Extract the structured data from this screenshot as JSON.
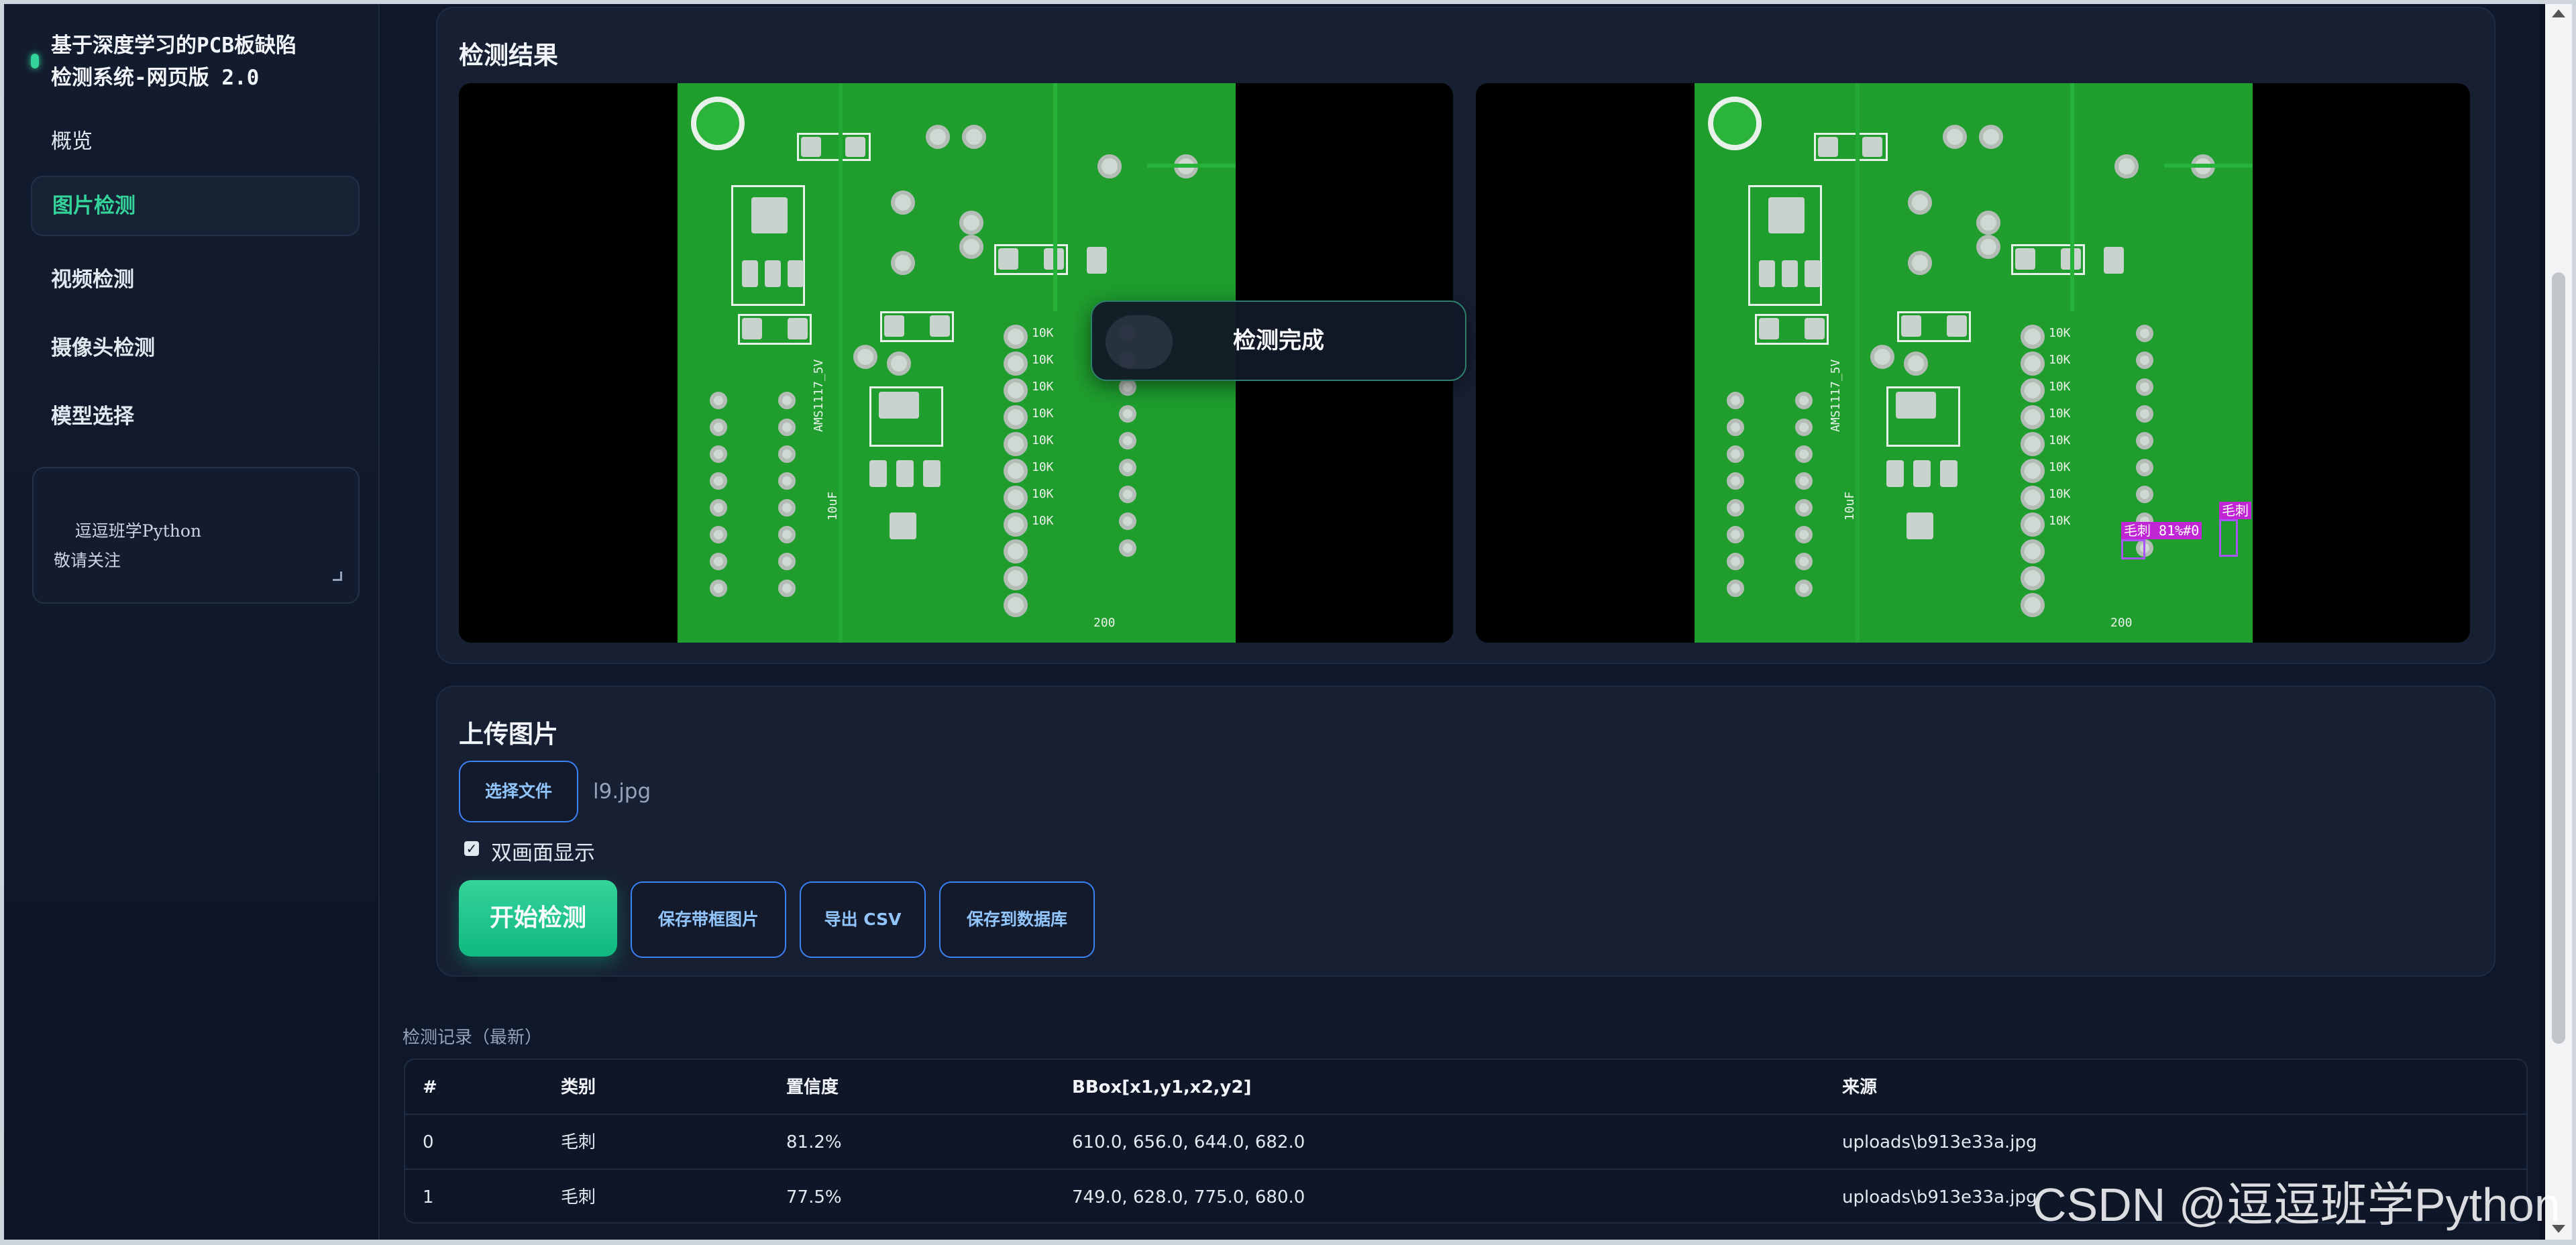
{
  "sidebar": {
    "title": "基于深度学习的PCB板缺陷\n检测系统-网页版 2.0",
    "items": [
      {
        "label": "概览"
      },
      {
        "label": "图片检测"
      },
      {
        "label": "视频检测"
      },
      {
        "label": "摄像头检测"
      },
      {
        "label": "模型选择"
      }
    ],
    "note": "逗逗班学Python\n敬请关注"
  },
  "results": {
    "title": "检测结果",
    "toast": "检测完成",
    "detections": [
      {
        "label": "毛刺 81%#0"
      },
      {
        "label": "毛刺"
      }
    ],
    "pcb_labels": [
      "10K",
      "10uF",
      "AMS1117_5V",
      "200"
    ]
  },
  "upload": {
    "title": "上传图片",
    "choose_label": "选择文件",
    "filename": "l9.jpg",
    "dual_label": "双画面显示",
    "start_label": "开始检测",
    "save_boxed_label": "保存带框图片",
    "export_csv_label": "导出 CSV",
    "save_db_label": "保存到数据库"
  },
  "records": {
    "caption": "检测记录（最新）",
    "headers": [
      "#",
      "类别",
      "置信度",
      "BBox[x1,y1,x2,y2]",
      "来源"
    ],
    "rows": [
      [
        "0",
        "毛刺",
        "81.2%",
        "610.0, 656.0, 644.0, 682.0",
        "uploads\\b913e33a.jpg"
      ],
      [
        "1",
        "毛刺",
        "77.5%",
        "749.0, 628.0, 775.0, 680.0",
        "uploads\\b913e33a.jpg"
      ]
    ]
  },
  "watermark": "CSDN @逗逗班学Python",
  "colors": {
    "accent": "#34d399",
    "button_border": "#3b82f6",
    "detection": "#c026d3"
  }
}
